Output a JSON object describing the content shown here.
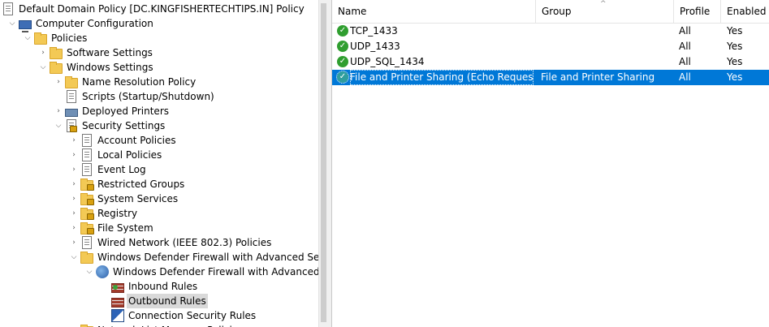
{
  "tree": [
    {
      "label": "Default Domain Policy [DC.KINGFISHERTECHTIPS.IN] Policy",
      "indent": 0,
      "chevron": "",
      "icon": "doc",
      "icon_name": "policy-document-icon"
    },
    {
      "label": "Computer Configuration",
      "indent": 1,
      "chevron": "down",
      "icon": "computer",
      "icon_name": "computer-icon"
    },
    {
      "label": "Policies",
      "indent": 2,
      "chevron": "down",
      "icon": "folder",
      "icon_name": "folder-icon"
    },
    {
      "label": "Software Settings",
      "indent": 3,
      "chevron": "right",
      "icon": "folder",
      "icon_name": "folder-icon"
    },
    {
      "label": "Windows Settings",
      "indent": 3,
      "chevron": "down",
      "icon": "folder",
      "icon_name": "folder-icon"
    },
    {
      "label": "Name Resolution Policy",
      "indent": 4,
      "chevron": "right",
      "icon": "folder",
      "icon_name": "folder-icon"
    },
    {
      "label": "Scripts (Startup/Shutdown)",
      "indent": 4,
      "chevron": "",
      "icon": "doc",
      "icon_name": "script-icon"
    },
    {
      "label": "Deployed Printers",
      "indent": 4,
      "chevron": "right",
      "icon": "pc",
      "icon_name": "printer-icon"
    },
    {
      "label": "Security Settings",
      "indent": 4,
      "chevron": "down",
      "icon": "doc lock",
      "icon_name": "security-settings-icon"
    },
    {
      "label": "Account Policies",
      "indent": 5,
      "chevron": "right",
      "icon": "doc",
      "icon_name": "account-policies-icon"
    },
    {
      "label": "Local Policies",
      "indent": 5,
      "chevron": "right",
      "icon": "doc",
      "icon_name": "local-policies-icon"
    },
    {
      "label": "Event Log",
      "indent": 5,
      "chevron": "right",
      "icon": "doc",
      "icon_name": "event-log-icon"
    },
    {
      "label": "Restricted Groups",
      "indent": 5,
      "chevron": "right",
      "icon": "folder lock",
      "icon_name": "locked-folder-icon"
    },
    {
      "label": "System Services",
      "indent": 5,
      "chevron": "right",
      "icon": "folder lock",
      "icon_name": "locked-folder-icon"
    },
    {
      "label": "Registry",
      "indent": 5,
      "chevron": "right",
      "icon": "folder lock",
      "icon_name": "locked-folder-icon"
    },
    {
      "label": "File System",
      "indent": 5,
      "chevron": "right",
      "icon": "folder lock",
      "icon_name": "locked-folder-icon"
    },
    {
      "label": "Wired Network (IEEE 802.3) Policies",
      "indent": 5,
      "chevron": "right",
      "icon": "doc",
      "icon_name": "wired-network-icon"
    },
    {
      "label": "Windows Defender Firewall with Advanced Securit",
      "indent": 5,
      "chevron": "down",
      "icon": "folder",
      "icon_name": "folder-icon"
    },
    {
      "label": "Windows Defender Firewall with Advanced Sec",
      "indent": 6,
      "chevron": "down",
      "icon": "globe",
      "icon_name": "firewall-globe-icon"
    },
    {
      "label": "Inbound Rules",
      "indent": 7,
      "chevron": "",
      "icon": "firewall green",
      "icon_name": "inbound-rules-icon"
    },
    {
      "label": "Outbound Rules",
      "indent": 7,
      "chevron": "",
      "icon": "firewall",
      "icon_name": "outbound-rules-icon",
      "selected": true
    },
    {
      "label": "Connection Security Rules",
      "indent": 7,
      "chevron": "",
      "icon": "conn",
      "icon_name": "connection-security-icon"
    },
    {
      "label": "Network List Manager Policies",
      "indent": 5,
      "chevron": "",
      "icon": "folder",
      "icon_name": "folder-icon"
    }
  ],
  "list": {
    "columns": [
      {
        "key": "name",
        "label": "Name"
      },
      {
        "key": "group",
        "label": "Group"
      },
      {
        "key": "profile",
        "label": "Profile"
      },
      {
        "key": "enabled",
        "label": "Enabled"
      }
    ],
    "rows": [
      {
        "name": "TCP_1433",
        "group": "",
        "profile": "All",
        "enabled": "Yes"
      },
      {
        "name": "UDP_1433",
        "group": "",
        "profile": "All",
        "enabled": "Yes"
      },
      {
        "name": "UDP_SQL_1434",
        "group": "",
        "profile": "All",
        "enabled": "Yes"
      },
      {
        "name": "File and Printer Sharing (Echo Request - I...",
        "group": "File and Printer Sharing",
        "profile": "All",
        "enabled": "Yes",
        "selected": true
      }
    ]
  },
  "icons": {
    "check": "✓",
    "chevron_down": "⌵",
    "chevron_right": "›",
    "sort_up": "^"
  }
}
